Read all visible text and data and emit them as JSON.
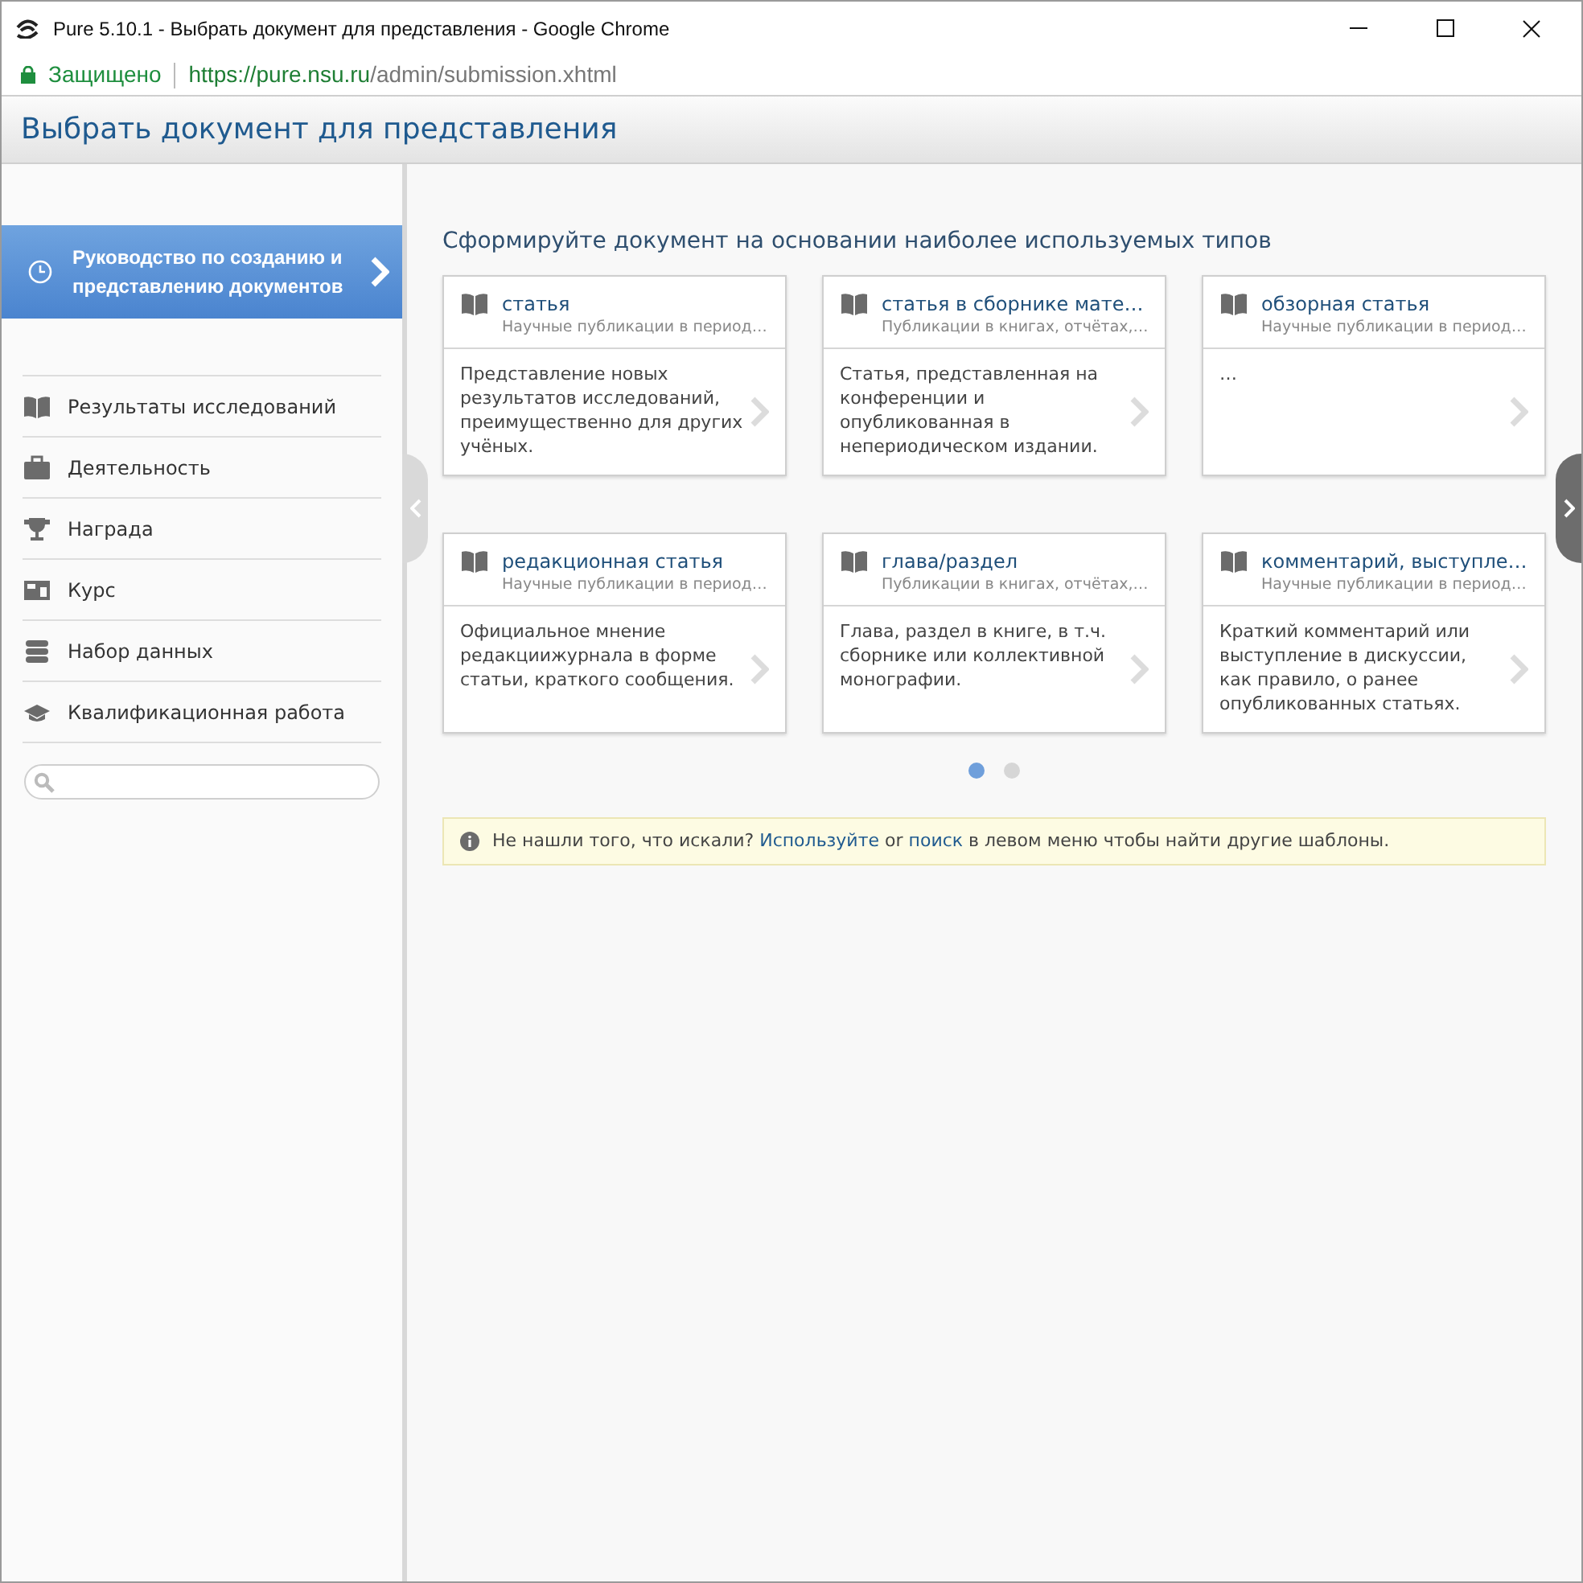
{
  "window": {
    "title": "Pure 5.10.1 - Выбрать документ для представления - Google Chrome"
  },
  "address_bar": {
    "security": "Защищено",
    "url_host": "https://pure.nsu.ru",
    "url_path": "/admin/submission.xhtml"
  },
  "header": {
    "title": "Выбрать документ для представления"
  },
  "sidebar": {
    "guide": {
      "label": "Руководство по созданию и представлению документов"
    },
    "items": [
      {
        "label": "Результаты исследований",
        "kind": "book"
      },
      {
        "label": "Деятельность",
        "kind": "briefcase"
      },
      {
        "label": "Награда",
        "kind": "trophy"
      },
      {
        "label": "Курс",
        "kind": "course"
      },
      {
        "label": "Набор данных",
        "kind": "database"
      },
      {
        "label": "Квалификационная работа",
        "kind": "cap"
      }
    ]
  },
  "content": {
    "heading": "Сформируйте документ на основании наиболее используемых типов",
    "cards": [
      {
        "title": "статья",
        "subtitle": "Научные публикации в период…",
        "description": "Представление новых результатов исследований, преимущественно для других учёных."
      },
      {
        "title": "статья в сборнике мате…",
        "subtitle": "Публикации в книгах, отчётах,…",
        "description": "Статья, представленная на конференции и опубликованная в непериодическом издании."
      },
      {
        "title": "обзорная статья",
        "subtitle": "Научные публикации в период…",
        "description": "…"
      },
      {
        "title": "редакционная статья",
        "subtitle": "Научные публикации в период…",
        "description": "Официальное мнение редакциижурнала в форме статьи, краткого сообщения."
      },
      {
        "title": "глава/раздел",
        "subtitle": "Публикации в книгах, отчётах,…",
        "description": "Глава, раздел в книге, в т.ч. сборнике или коллективной монографии."
      },
      {
        "title": "комментарий, выступле…",
        "subtitle": "Научные публикации в период…",
        "description": "Краткий комментарий или выступление в дискуссии, как правило, о ранее опубликованных статьях."
      }
    ],
    "pages": [
      {
        "selected": true
      },
      {
        "selected": false
      }
    ],
    "notice": [
      {
        "kind": "text",
        "text": "Не нашли того, что искали?"
      },
      {
        "kind": "link",
        "text": "Используйте"
      },
      {
        "kind": "text",
        "text": "or"
      },
      {
        "kind": "link",
        "text": "поиск"
      },
      {
        "kind": "text",
        "text": "в левом меню чтобы найти другие шаблоны."
      }
    ]
  }
}
